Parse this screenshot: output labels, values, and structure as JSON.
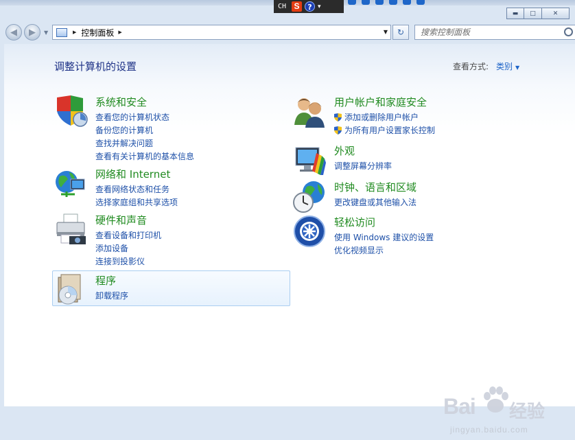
{
  "ime": {
    "lang": "CH",
    "s_logo": "S",
    "help": "?"
  },
  "window": {
    "min": "▬",
    "max": "□",
    "close": "✕"
  },
  "nav": {
    "breadcrumb": "控制面板",
    "search_placeholder": "搜索控制面板"
  },
  "page": {
    "title": "调整计算机的设置",
    "view_by_label": "查看方式:",
    "view_by_value": "类别"
  },
  "categories": {
    "system": {
      "title": "系统和安全",
      "links": [
        "查看您的计算机状态",
        "备份您的计算机",
        "查找并解决问题",
        "查看有关计算机的基本信息"
      ]
    },
    "network": {
      "title": "网络和 Internet",
      "links": [
        "查看网络状态和任务",
        "选择家庭组和共享选项"
      ]
    },
    "hardware": {
      "title": "硬件和声音",
      "links": [
        "查看设备和打印机",
        "添加设备",
        "连接到投影仪"
      ]
    },
    "programs": {
      "title": "程序",
      "links": [
        "卸载程序"
      ]
    },
    "users": {
      "title": "用户帐户和家庭安全",
      "links": [
        "添加或删除用户帐户",
        "为所有用户设置家长控制"
      ]
    },
    "appearance": {
      "title": "外观",
      "links": [
        "调整屏幕分辨率"
      ]
    },
    "clock": {
      "title": "时钟、语言和区域",
      "links": [
        "更改键盘或其他输入法"
      ]
    },
    "ease": {
      "title": "轻松访问",
      "links": [
        "使用 Windows 建议的设置",
        "优化视频显示"
      ]
    }
  },
  "watermark": {
    "brand_left": "Bai",
    "brand_right": "经验",
    "url": "jingyan.baidu.com"
  },
  "colors": {
    "category_title": "#1f8a1f",
    "link": "#1e50a8",
    "heading": "#1e3287"
  }
}
